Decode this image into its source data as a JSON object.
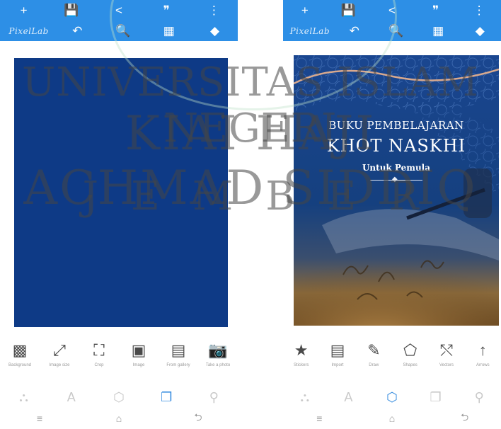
{
  "left_phone": {
    "brand": "PixelLab",
    "top_row1": [
      "+",
      "💾",
      "<",
      "❞",
      "⋮"
    ],
    "top_row2": [
      "↶",
      "🔍",
      "▦",
      "◆"
    ],
    "tools": [
      {
        "icon": "▩",
        "label": "Background",
        "name": "background-icon"
      },
      {
        "icon": "⤢",
        "label": "Image size",
        "name": "image-size-icon"
      },
      {
        "icon": "⛶",
        "label": "Crop",
        "name": "crop-icon"
      },
      {
        "icon": "▣",
        "label": "Image",
        "name": "image-icon"
      },
      {
        "icon": "▤",
        "label": "From gallery",
        "name": "from-gallery-icon"
      },
      {
        "icon": "📷",
        "label": "Take a photo",
        "name": "camera-icon"
      }
    ],
    "modes": [
      "⛬",
      "A",
      "⬡",
      "❐",
      "⚲"
    ],
    "active_mode": 3,
    "nav": [
      "≡",
      "⌂",
      "⮌"
    ]
  },
  "right_phone": {
    "brand": "PixelLab",
    "top_row1": [
      "+",
      "💾",
      "<",
      "❞",
      "⋮"
    ],
    "top_row2": [
      "↶",
      "🔍",
      "▦",
      "◆"
    ],
    "tools": [
      {
        "icon": "★",
        "label": "Stickers",
        "name": "stickers-icon"
      },
      {
        "icon": "▤",
        "label": "Import",
        "name": "import-icon"
      },
      {
        "icon": "✎",
        "label": "Draw",
        "name": "draw-icon"
      },
      {
        "icon": "⬠",
        "label": "Shapes",
        "name": "shapes-icon"
      },
      {
        "icon": "⤲",
        "label": "Vectors",
        "name": "vectors-icon"
      },
      {
        "icon": "↑",
        "label": "Arrows",
        "name": "arrow-up-icon"
      }
    ],
    "modes": [
      "⛬",
      "A",
      "⬡",
      "❐",
      "⚲"
    ],
    "active_mode": 2,
    "nav": [
      "≡",
      "⌂",
      "⮌"
    ],
    "cover": {
      "line1": "BUKU PEMBELAJARAN",
      "line2": "KHOT NASKHI",
      "line3": "Untuk Pemula"
    }
  },
  "watermark": {
    "line1": "UNIVERSITAS ISLAM NEGERI",
    "line2": "KIAI HAJI ACHMAD SIDDIQ",
    "line3": "JEMBER"
  },
  "colors": {
    "toolbar": "#2d8fe6",
    "canvas_blue": "#0e3a86",
    "active_mode": "#3b8fe0"
  }
}
